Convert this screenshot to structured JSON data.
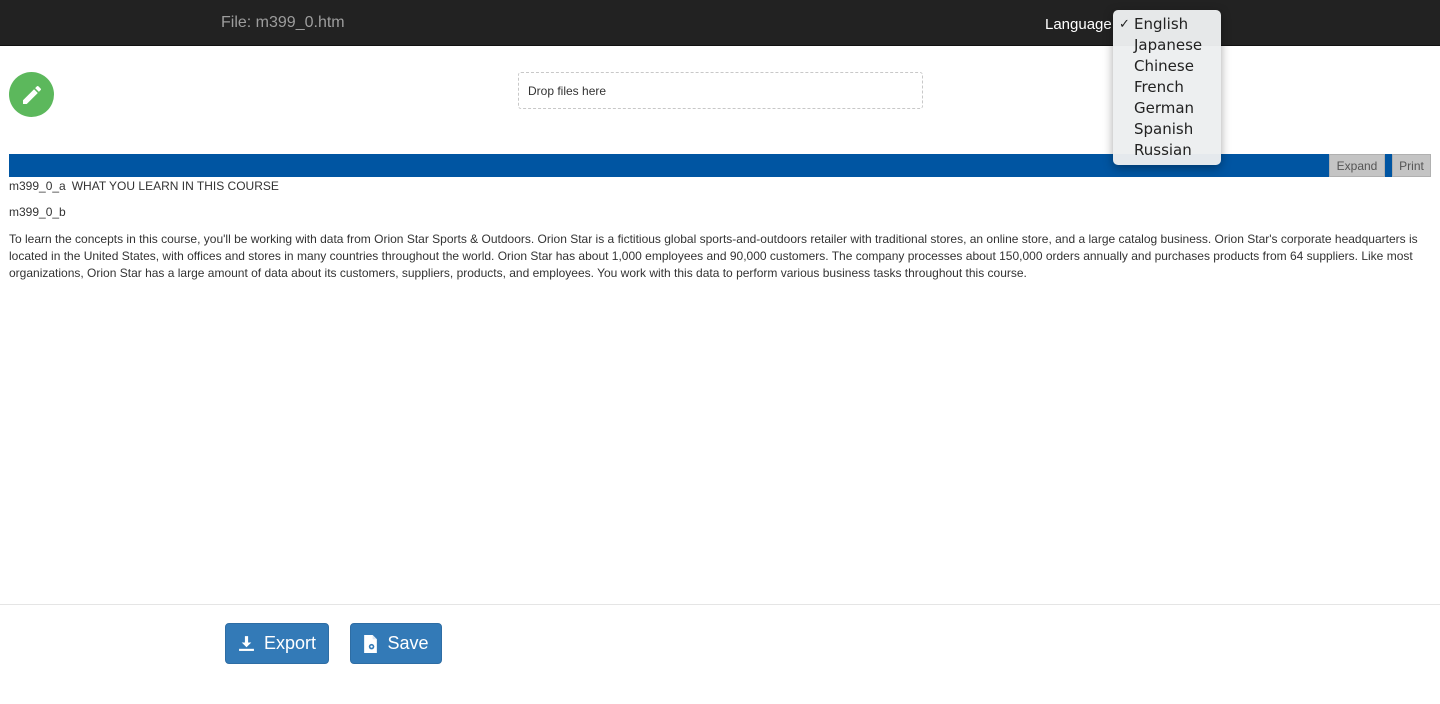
{
  "header": {
    "file_title": "File: m399_0.htm",
    "language_label": "Language"
  },
  "language_menu": {
    "selected": "English",
    "check_mark": "✓",
    "options": [
      "English",
      "Japanese",
      "Chinese",
      "French",
      "German",
      "Spanish",
      "Russian"
    ]
  },
  "dropzone": {
    "label": "Drop files here"
  },
  "section": {
    "expand_label": "Expand",
    "print_label": "Print",
    "bar_color": "#0055a2"
  },
  "content": {
    "id_a": "m399_0_a",
    "heading": "WHAT YOU LEARN IN THIS COURSE",
    "id_b": "m399_0_b",
    "paragraph": "To learn the concepts in this course, you'll be working with data from Orion Star Sports & Outdoors. Orion Star is a fictitious global sports-and-outdoors retailer with traditional stores, an online store, and a large catalog business. Orion Star's corporate headquarters is located in the United States, with offices and stores in many countries throughout the world. Orion Star has about 1,000 employees and 90,000 customers. The company processes about 150,000 orders annually and purchases products from 64 suppliers. Like most organizations, Orion Star has a large amount of data about its customers, suppliers, products, and employees. You work with this data to perform various business tasks throughout this course."
  },
  "footer": {
    "export_label": "Export",
    "save_label": "Save"
  },
  "icons": {
    "edit": "pencil-icon",
    "export": "download-icon",
    "save": "save-file-icon"
  },
  "colors": {
    "topbar": "#222222",
    "edit_button": "#5cb85c",
    "primary_button": "#337ab7"
  }
}
